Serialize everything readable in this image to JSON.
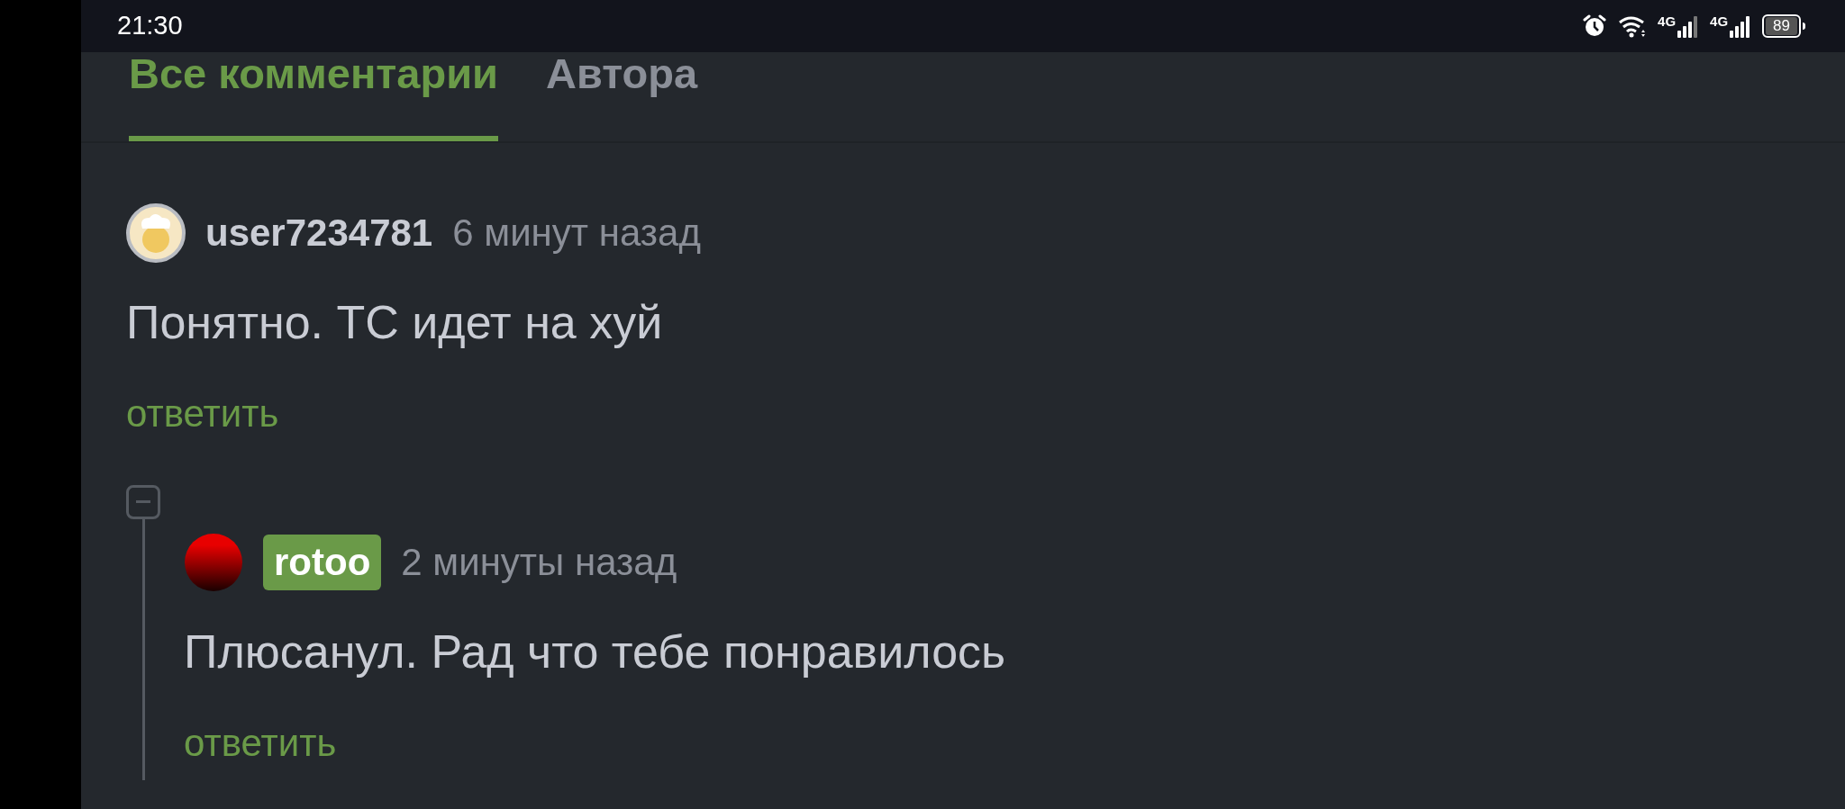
{
  "status_bar": {
    "time": "21:30",
    "network_1": "4G",
    "network_2": "4G",
    "battery": "89"
  },
  "tabs": [
    {
      "label": "Все комментарии",
      "selected": true
    },
    {
      "label": "Автора",
      "selected": false
    }
  ],
  "comments": [
    {
      "avatar": {
        "kind": "chef"
      },
      "author": "user7234781",
      "author_highlighted": false,
      "time": "6 минут назад",
      "text": "Понятно. ТС идет на хуй",
      "reply": "ответить",
      "expanded": true,
      "children": [
        {
          "avatar": {
            "kind": "ball"
          },
          "author": "rotoo",
          "author_highlighted": true,
          "time": "2 минуты назад",
          "text": "Плюсанул. Рад что тебе понравилось",
          "reply": "ответить"
        }
      ]
    }
  ]
}
